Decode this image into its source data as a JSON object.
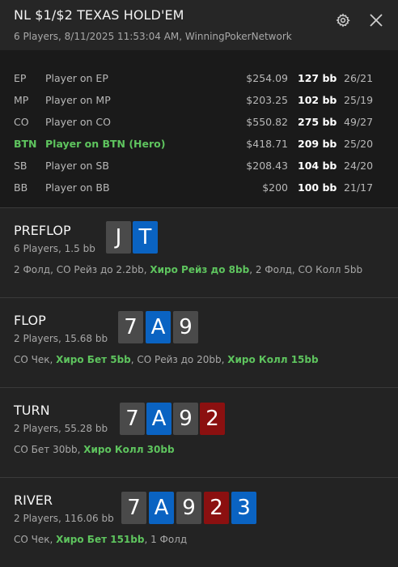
{
  "header": {
    "title": "NL $1/$2 TEXAS HOLD'EM",
    "subtitle": "6 Players, 8/11/2025 11:53:04 AM, WinningPokerNetwork",
    "settings_icon": "gear-icon",
    "close_icon": "close-icon"
  },
  "players": [
    {
      "pos": "EP",
      "name": "Player on EP",
      "stack": "$254.09",
      "bb": "127 bb",
      "stats": "26/21",
      "hero": false
    },
    {
      "pos": "MP",
      "name": "Player on MP",
      "stack": "$203.25",
      "bb": "102 bb",
      "stats": "25/19",
      "hero": false
    },
    {
      "pos": "CO",
      "name": "Player on CO",
      "stack": "$550.82",
      "bb": "275 bb",
      "stats": "49/27",
      "hero": false
    },
    {
      "pos": "BTN",
      "name": "Player on BTN (Hero)",
      "stack": "$418.71",
      "bb": "209 bb",
      "stats": "25/20",
      "hero": true
    },
    {
      "pos": "SB",
      "name": "Player on SB",
      "stack": "$208.43",
      "bb": "104 bb",
      "stats": "24/20",
      "hero": false
    },
    {
      "pos": "BB",
      "name": "Player on BB",
      "stack": "$200",
      "bb": "100 bb",
      "stats": "21/17",
      "hero": false
    }
  ],
  "colors": {
    "hero_green": "#5ec45e",
    "card_gray": "#4a4a4a",
    "card_blue": "#0a63c2",
    "card_red": "#8b1010"
  },
  "streets": [
    {
      "name": "PREFLOP",
      "info": "6 Players, 1.5 bb",
      "cards": [
        {
          "rank": "J",
          "suit": "gray"
        },
        {
          "rank": "T",
          "suit": "blue"
        }
      ],
      "actions": [
        {
          "text": "2 Фолд, CO Рейз до 2.2bb, ",
          "hero": false
        },
        {
          "text": "Хиро Рейз до 8bb",
          "hero": true
        },
        {
          "text": ", 2 Фолд, CO Колл 5bb",
          "hero": false
        }
      ]
    },
    {
      "name": "FLOP",
      "info": "2 Players, 15.68 bb",
      "cards": [
        {
          "rank": "7",
          "suit": "gray"
        },
        {
          "rank": "A",
          "suit": "blue"
        },
        {
          "rank": "9",
          "suit": "gray"
        }
      ],
      "actions": [
        {
          "text": "CO Чек, ",
          "hero": false
        },
        {
          "text": "Хиро Бет 5bb",
          "hero": true
        },
        {
          "text": ", CO Рейз до 20bb, ",
          "hero": false
        },
        {
          "text": "Хиро Колл 15bb",
          "hero": true
        }
      ]
    },
    {
      "name": "TURN",
      "info": "2 Players, 55.28 bb",
      "cards": [
        {
          "rank": "7",
          "suit": "gray"
        },
        {
          "rank": "A",
          "suit": "blue"
        },
        {
          "rank": "9",
          "suit": "gray"
        },
        {
          "rank": "2",
          "suit": "red"
        }
      ],
      "actions": [
        {
          "text": "CO Бет 30bb, ",
          "hero": false
        },
        {
          "text": "Хиро Колл 30bb",
          "hero": true
        }
      ]
    },
    {
      "name": "RIVER",
      "info": "2 Players, 116.06 bb",
      "cards": [
        {
          "rank": "7",
          "suit": "gray"
        },
        {
          "rank": "A",
          "suit": "blue"
        },
        {
          "rank": "9",
          "suit": "gray"
        },
        {
          "rank": "2",
          "suit": "red"
        },
        {
          "rank": "3",
          "suit": "blue"
        }
      ],
      "actions": [
        {
          "text": "CO Чек, ",
          "hero": false
        },
        {
          "text": "Хиро Бет 151bb",
          "hero": true
        },
        {
          "text": ", 1 Фолд",
          "hero": false
        }
      ]
    }
  ]
}
